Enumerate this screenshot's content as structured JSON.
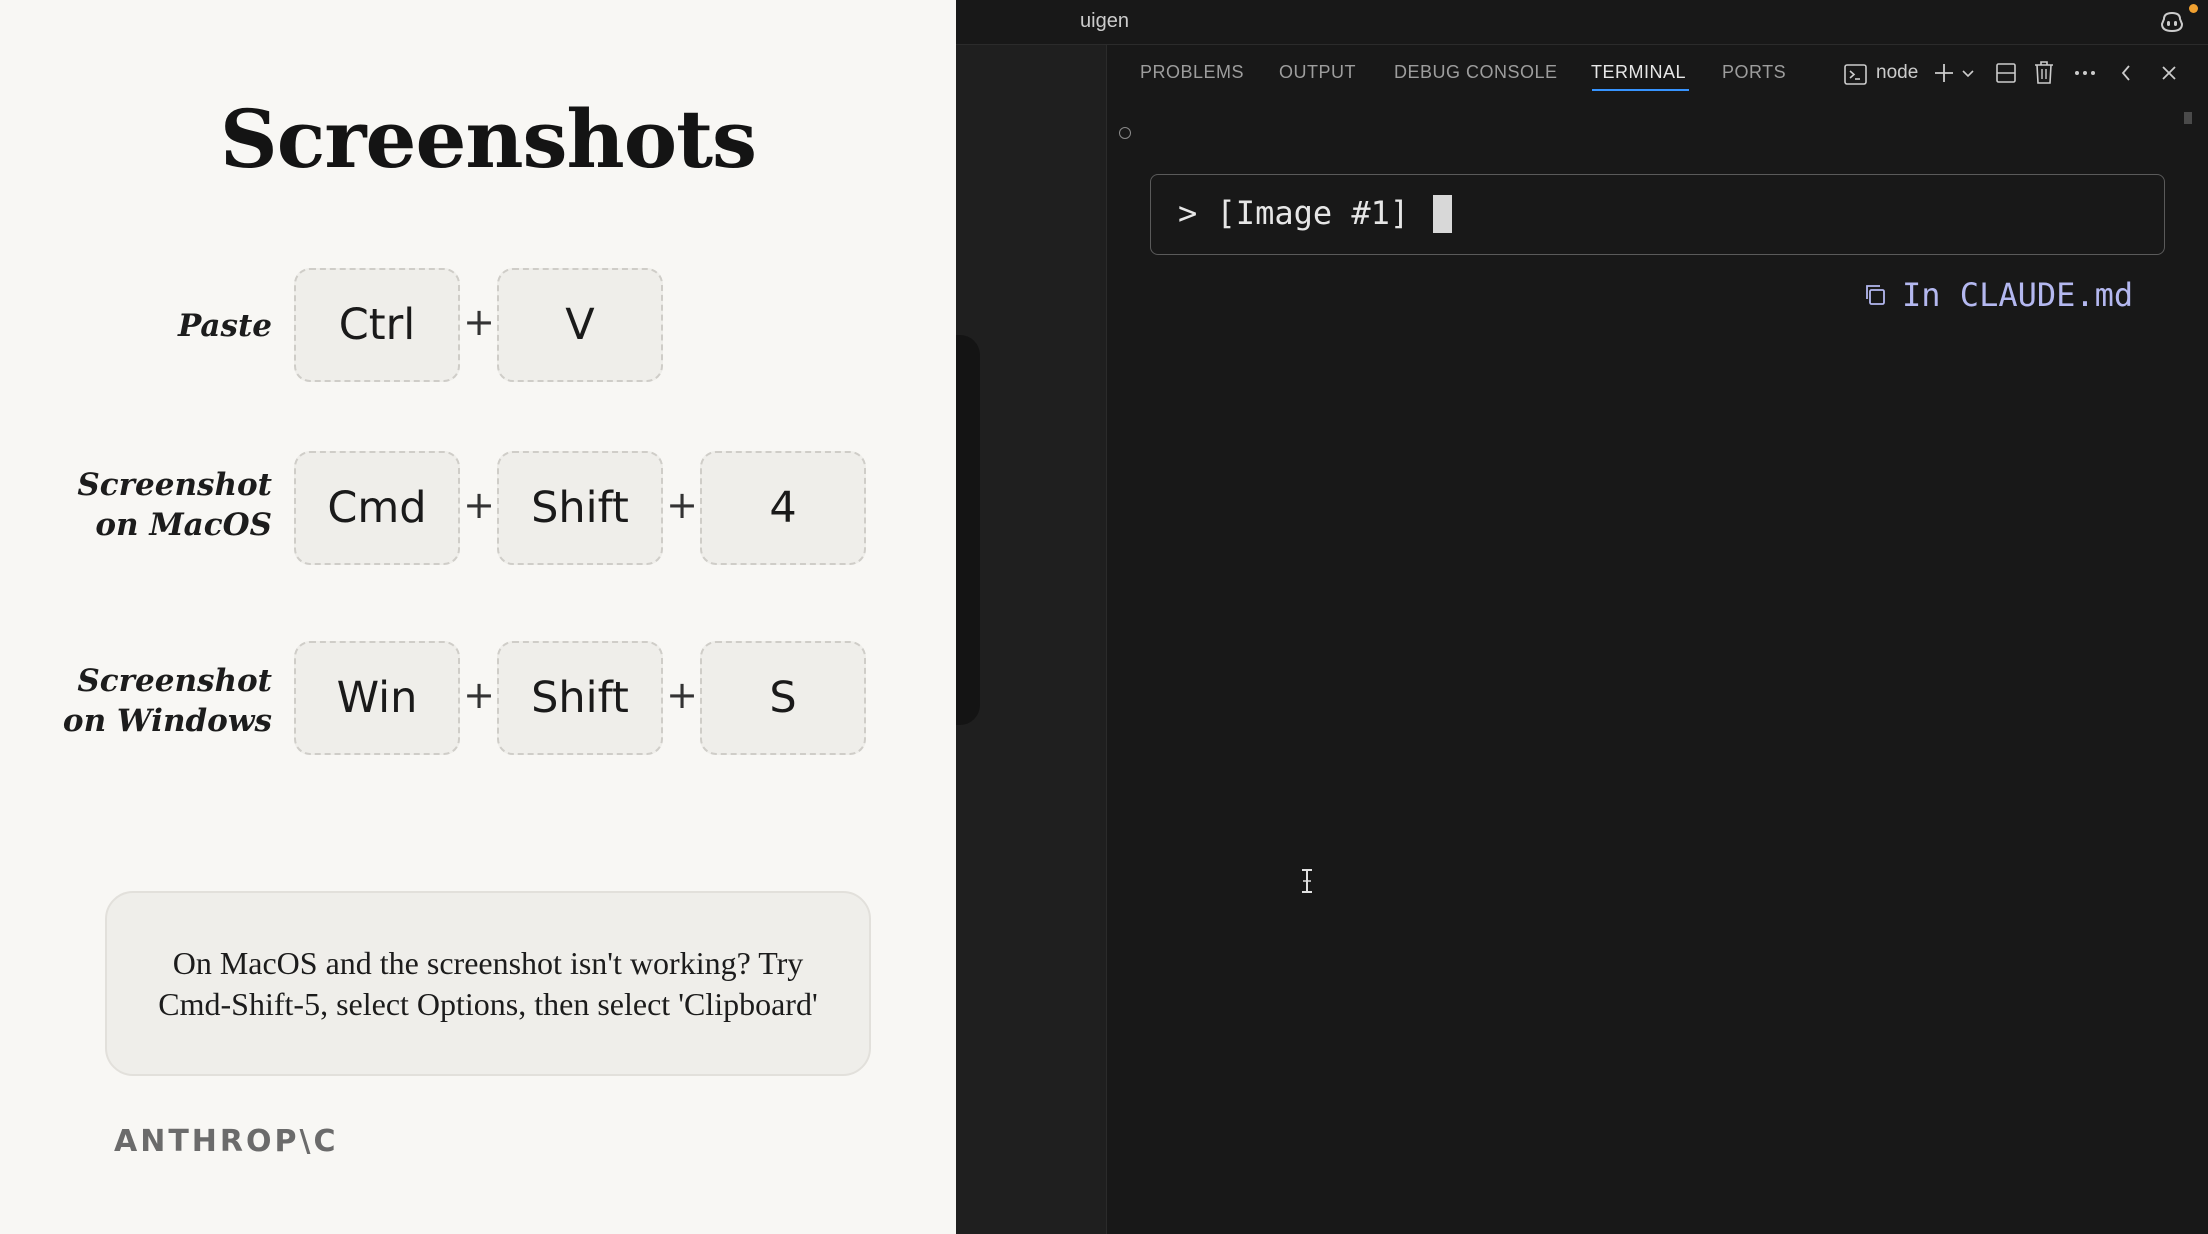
{
  "slide": {
    "title": "Screenshots",
    "shortcuts": [
      {
        "label_lines": [
          "Paste"
        ],
        "keys": [
          "Ctrl",
          "V"
        ]
      },
      {
        "label_lines": [
          "Screenshot",
          "on MacOS"
        ],
        "keys": [
          "Cmd",
          "Shift",
          "4"
        ]
      },
      {
        "label_lines": [
          "Screenshot",
          "on Windows"
        ],
        "keys": [
          "Win",
          "Shift",
          "S"
        ]
      }
    ],
    "plus": "+",
    "tip": "On MacOS and the screenshot isn't working? Try Cmd-Shift-5, select Options, then select 'Clipboard'",
    "logo": "ANTHROP\\C"
  },
  "ide": {
    "window_title": "uigen",
    "panel_tabs": [
      "PROBLEMS",
      "OUTPUT",
      "DEBUG CONSOLE",
      "TERMINAL",
      "PORTS"
    ],
    "active_tab": "TERMINAL",
    "terminal_name": "node",
    "icons": [
      "terminal-icon",
      "plus-icon",
      "chevron-down-icon",
      "split-icon",
      "trash-icon",
      "more-icon",
      "chevron-left-icon",
      "close-icon",
      "copilot-icon"
    ],
    "prompt_symbol": ">",
    "input_text": "[Image #1]",
    "hint": "In CLAUDE.md",
    "colors": {
      "accent": "#3794ff",
      "hint": "#b4b8f0",
      "badge": "#f0a030"
    }
  }
}
